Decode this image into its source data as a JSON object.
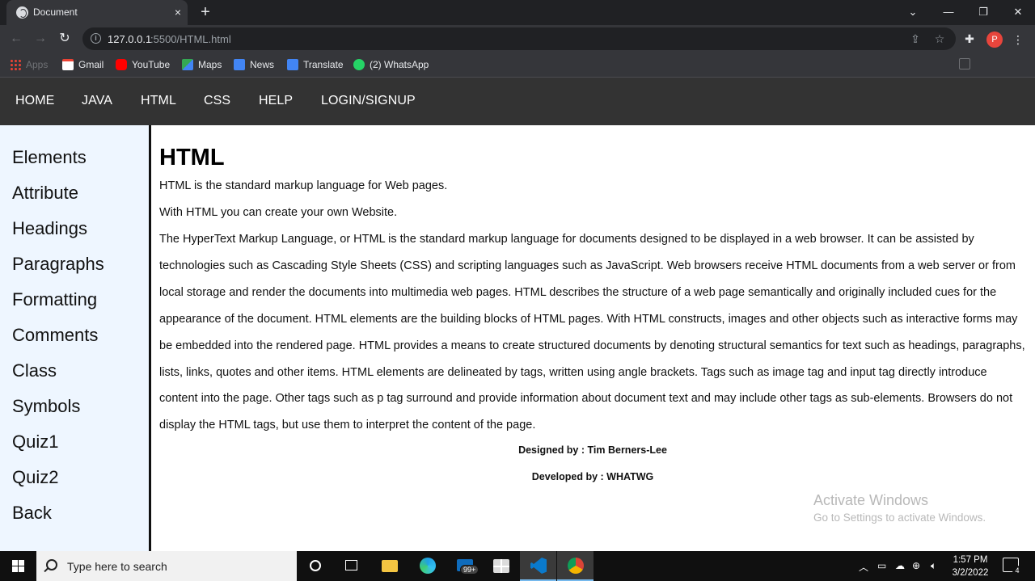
{
  "browser": {
    "tab_title": "Document",
    "tab_close": "×",
    "new_tab": "+",
    "window_controls": {
      "dropdown": "⌄",
      "minimize": "—",
      "restore": "❐",
      "close": "✕"
    },
    "nav": {
      "back": "←",
      "forward": "→",
      "reload": "↻"
    },
    "url_host": "127.0.0.1",
    "url_path": ":5500/HTML.html",
    "profile_initial": "P",
    "bookmarks": [
      {
        "label": "Apps",
        "icon": "apps-grid-icon",
        "color": "#e8eaed"
      },
      {
        "label": "Gmail",
        "icon": "gmail-icon",
        "color": "#ea4335"
      },
      {
        "label": "YouTube",
        "icon": "youtube-icon",
        "color": "#ff0000"
      },
      {
        "label": "Maps",
        "icon": "maps-icon",
        "color": "#34a853"
      },
      {
        "label": "News",
        "icon": "news-icon",
        "color": "#4285f4"
      },
      {
        "label": "Translate",
        "icon": "translate-icon",
        "color": "#4285f4"
      },
      {
        "label": "(2) WhatsApp",
        "icon": "whatsapp-icon",
        "color": "#25d366"
      }
    ]
  },
  "site": {
    "topnav": [
      "HOME",
      "JAVA",
      "HTML",
      "CSS",
      "HELP",
      "LOGIN/SIGNUP"
    ],
    "sidenav": [
      "Elements",
      "Attribute",
      "Headings",
      "Paragraphs",
      "Formatting",
      "Comments",
      "Class",
      "Symbols",
      "Quiz1",
      "Quiz2",
      "Back"
    ],
    "heading": "HTML",
    "intro1": "HTML is the standard markup language for Web pages.",
    "intro2": "With HTML you can create your own Website.",
    "body": "The HyperText Markup Language, or HTML is the standard markup language for documents designed to be displayed in a web browser. It can be assisted by technologies such as Cascading Style Sheets (CSS) and scripting languages such as JavaScript. Web browsers receive HTML documents from a web server or from local storage and render the documents into multimedia web pages. HTML describes the structure of a web page semantically and originally included cues for the appearance of the document. HTML elements are the building blocks of HTML pages. With HTML constructs, images and other objects such as interactive forms may be embedded into the rendered page. HTML provides a means to create structured documents by denoting structural semantics for text such as headings, paragraphs, lists, links, quotes and other items. HTML elements are delineated by tags, written using angle brackets. Tags such as image tag and input tag directly introduce content into the page. Other tags such as p tag surround and provide information about document text and may include other tags as sub-elements. Browsers do not display the HTML tags, but use them to interpret the content of the page.",
    "designed_by": "Designed by : Tim Berners-Lee",
    "developed_by": "Developed by : WHATWG"
  },
  "watermark": {
    "line1": "Activate Windows",
    "line2": "Go to Settings to activate Windows."
  },
  "taskbar": {
    "search_placeholder": "Type here to search",
    "mail_badge": "99+",
    "time": "1:57 PM",
    "date": "3/2/2022",
    "notification_count": "4",
    "apps": [
      "cortana-icon",
      "task-view-icon",
      "file-explorer-icon",
      "edge-icon",
      "mail-icon",
      "store-icon",
      "vscode-icon",
      "chrome-icon"
    ],
    "colors": {
      "explorer": "#f4c542",
      "edge": "#1fa0e4",
      "vscode": "#0a7acc",
      "chrome_red": "#db4437",
      "chrome_yellow": "#f4b400",
      "chrome_green": "#0f9d58"
    }
  }
}
